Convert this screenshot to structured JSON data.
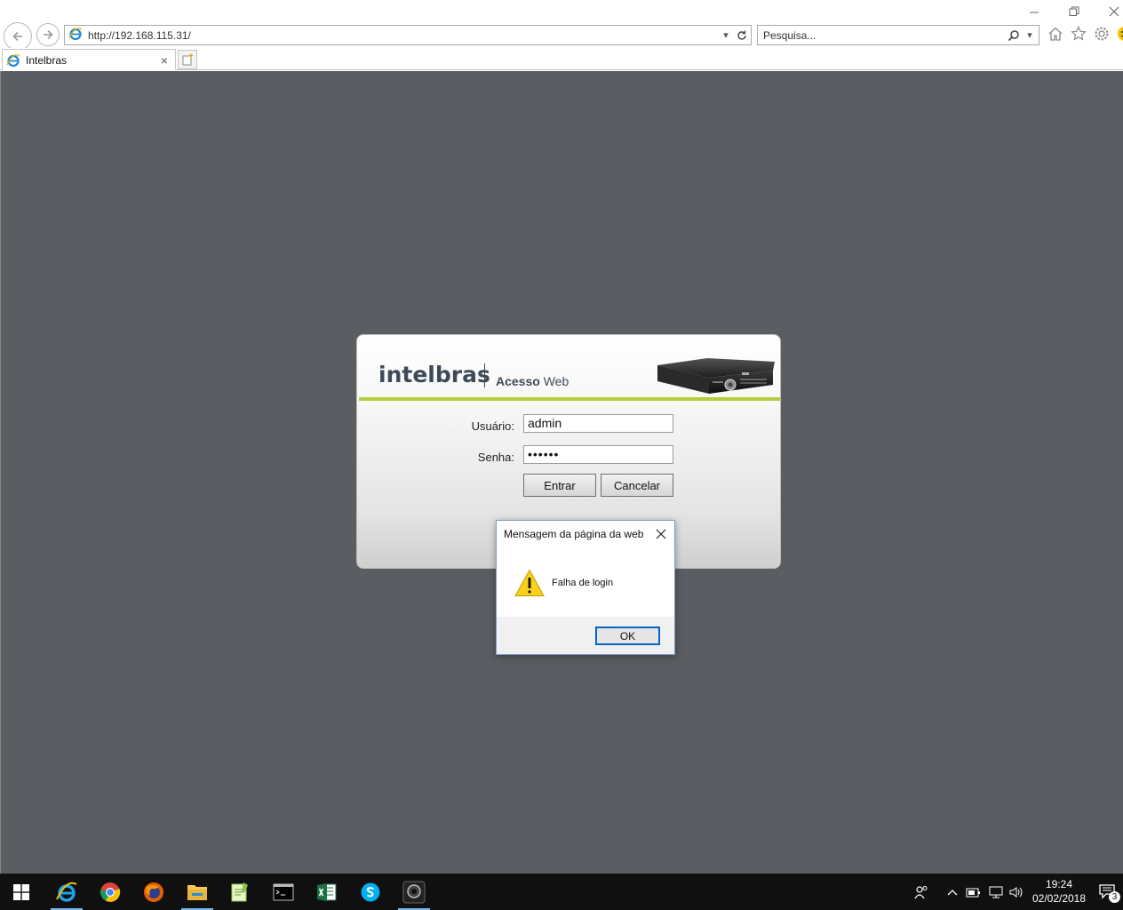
{
  "browser": {
    "address": "http://192.168.115.31/",
    "search_placeholder": "Pesquisa...",
    "tab_title": "Intelbras"
  },
  "login": {
    "brand": "intelbras",
    "brand_sub_bold": "Acesso",
    "brand_sub": "Web",
    "user_label": "Usuário:",
    "user_value": "admin",
    "password_label": "Senha:",
    "password_value": "••••••",
    "enter_button": "Entrar",
    "cancel_button": "Cancelar",
    "accent_color": "#b3cf3e"
  },
  "dialog": {
    "title": "Mensagem da página da web",
    "message": "Falha de login",
    "ok_button": "OK"
  },
  "taskbar": {
    "apps": [
      "internet-explorer-icon",
      "chrome-icon",
      "firefox-icon",
      "file-explorer-icon",
      "notepad-plus-icon",
      "terminal-icon",
      "excel-icon",
      "skype-icon",
      "intelbras-app-icon"
    ],
    "time": "19:24",
    "date": "02/02/2018",
    "notification_count": "3"
  }
}
